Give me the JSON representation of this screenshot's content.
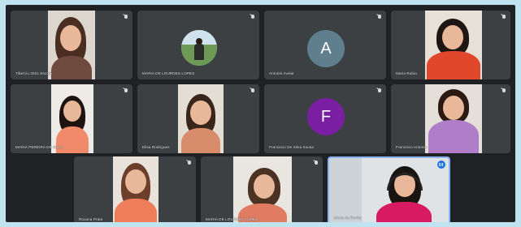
{
  "participants": [
    {
      "name": "Tibercio 2021 Escola",
      "avatar": "video"
    },
    {
      "name": "MARIA DE LOURDES LOPES",
      "avatar": "photo"
    },
    {
      "name": "Antonio Avelar",
      "avatar": "letter",
      "initial": "A",
      "color": "#5f7f8f"
    },
    {
      "name": "Maria Rubia",
      "avatar": "video"
    },
    {
      "name": "MARIA PEREIRA DE SILVA",
      "avatar": "video"
    },
    {
      "name": "Elisa Rodrigues",
      "avatar": "video"
    },
    {
      "name": "Francisco De Silva Sousa",
      "avatar": "letter",
      "initial": "F",
      "color": "#7b1fa2"
    },
    {
      "name": "Francisco Antonio",
      "avatar": "video"
    },
    {
      "name": "Roxana Prata",
      "avatar": "video"
    },
    {
      "name": "MARIA DE LOURDES LOPES",
      "avatar": "video"
    },
    {
      "name": "Maria da Rocha",
      "avatar": "video",
      "speaking": true
    }
  ],
  "icons": {
    "mic_muted": "mic-off-icon",
    "speaking": "audio-level-icon"
  }
}
